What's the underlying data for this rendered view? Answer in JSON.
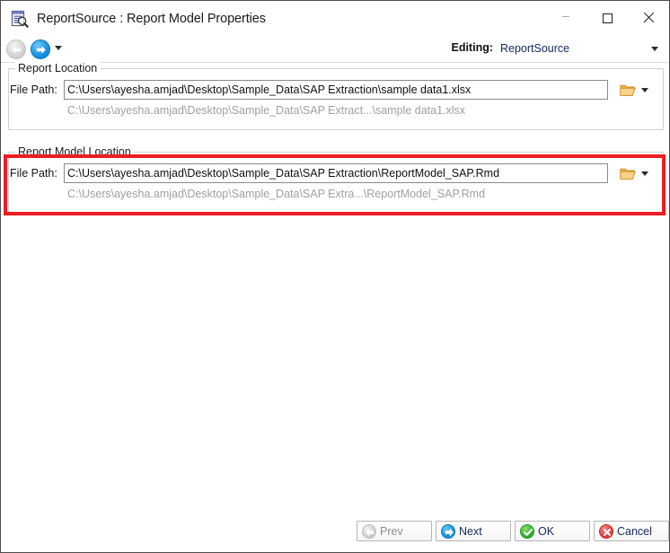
{
  "window": {
    "title": "ReportSource : Report Model Properties",
    "icon": "report-properties-icon",
    "minimize_label": "–",
    "maximize_label": "Maximize",
    "close_label": "Close"
  },
  "navbar": {
    "back_label": "Back",
    "forward_label": "Forward",
    "history_dropdown_label": "Recent pages",
    "editing_label": "Editing:",
    "editing_value": "ReportSource"
  },
  "report_location": {
    "group_title": "Report Location",
    "file_path_label": "File Path:",
    "file_path_value": "C:\\Users\\ayesha.amjad\\Desktop\\Sample_Data\\SAP Extraction\\sample data1.xlsx",
    "file_path_placeholder": "",
    "resolved_path_hint": "C:\\Users\\ayesha.amjad\\Desktop\\Sample_Data\\SAP Extract...\\sample data1.xlsx",
    "browse_label": "folder-open-icon",
    "browse_dropdown_label": "chevron-down-icon"
  },
  "report_model_location": {
    "group_title": "Report Model Location",
    "file_path_label": "File Path:",
    "file_path_value": "C:\\Users\\ayesha.amjad\\Desktop\\Sample_Data\\SAP Extraction\\ReportModel_SAP.Rmd",
    "file_path_placeholder": "",
    "resolved_path_hint": "C:\\Users\\ayesha.amjad\\Desktop\\Sample_Data\\SAP Extra...\\ReportModel_SAP.Rmd",
    "browse_label": "folder-open-icon",
    "browse_dropdown_label": "chevron-down-icon",
    "highlight_color": "#ee1c24"
  },
  "footer": {
    "prev_label": "Prev",
    "prev_enabled": false,
    "next_label": "Next",
    "ok_label": "OK",
    "cancel_label": "Cancel"
  },
  "colors": {
    "accent_blue": "#0f8fdd",
    "ok_green": "#2fae2f",
    "cancel_red": "#e33b3b",
    "highlight_red": "#ee1c24",
    "text_navy": "#16295e",
    "hint_gray": "#a0a0a0"
  }
}
